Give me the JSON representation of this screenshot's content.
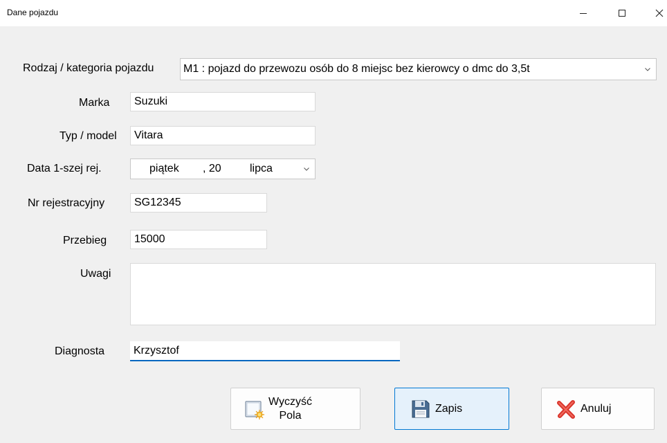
{
  "window": {
    "title": "Dane pojazdu"
  },
  "form": {
    "category": {
      "label": "Rodzaj / kategoria pojazdu",
      "value": "M1 : pojazd do przewozu osób do 8 miejsc bez kierowcy o dmc do 3,5t"
    },
    "brand": {
      "label": "Marka",
      "value": "Suzuki"
    },
    "model": {
      "label": "Typ / model",
      "value": "Vitara"
    },
    "first_reg": {
      "label": "Data 1-szej rej.",
      "day_name": "piątek",
      "day": ", 20",
      "month": "lipca"
    },
    "plate": {
      "label": "Nr rejestracyjny",
      "value": "SG12345"
    },
    "mileage": {
      "label": "Przebieg",
      "value": "15000"
    },
    "notes": {
      "label": "Uwagi",
      "value": ""
    },
    "inspector": {
      "label": "Diagnosta",
      "value": "Krzysztof"
    }
  },
  "buttons": {
    "clear_line1": "Wyczyść",
    "clear_line2": "Pola",
    "save": "Zapis",
    "cancel": "Anuluj"
  },
  "icons": {
    "clear": "clear-form-icon",
    "save": "floppy-disk-icon",
    "cancel": "red-x-icon"
  },
  "colors": {
    "accent": "#0078d4",
    "focus_underline": "#0067c0",
    "cancel_red": "#d9342b"
  }
}
